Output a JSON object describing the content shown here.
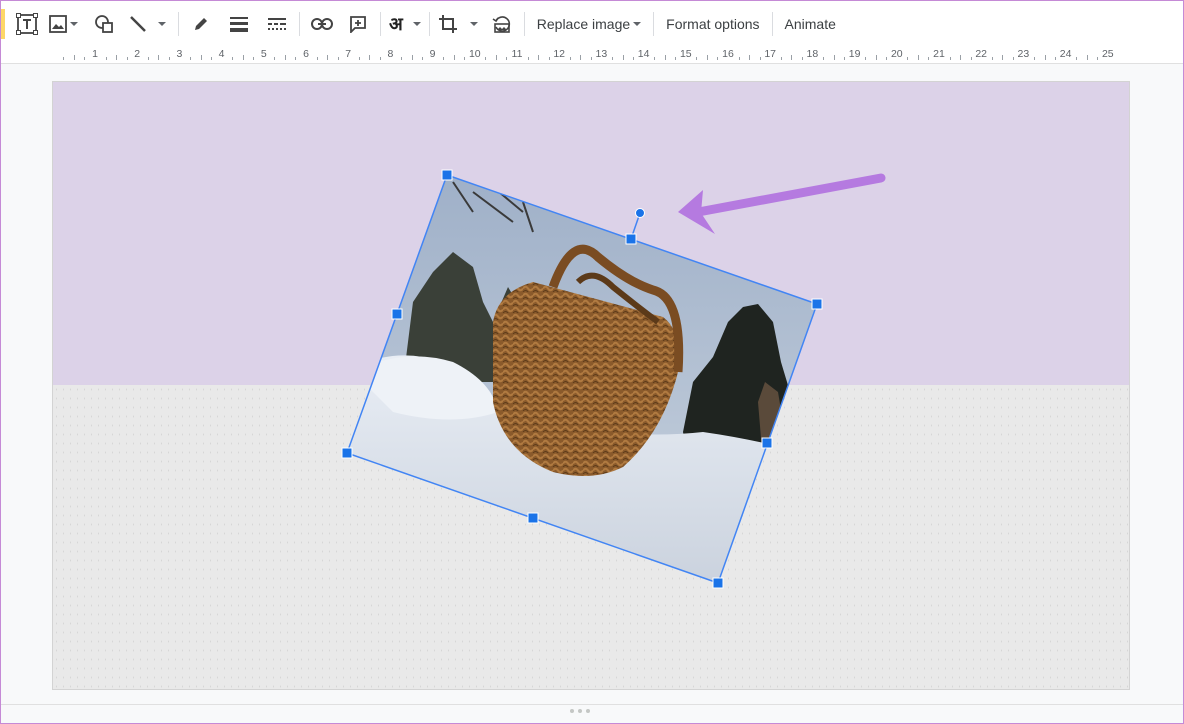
{
  "toolbar": {
    "icons": [
      "text-box-icon",
      "image-icon",
      "shape-icon",
      "line-icon",
      "pen-icon",
      "border-weight-icon",
      "border-dash-icon",
      "link-icon",
      "comment-icon",
      "input-tools-icon",
      "crop-icon",
      "reset-image-icon"
    ],
    "input_tool_glyph": "अ",
    "replace_image_label": "Replace image",
    "format_options_label": "Format options",
    "animate_label": "Animate"
  },
  "ruler": {
    "labels": [
      "1",
      "2",
      "3",
      "4",
      "5",
      "6",
      "7",
      "8",
      "9",
      "10",
      "11",
      "12",
      "13",
      "14",
      "15",
      "16",
      "17",
      "18",
      "19",
      "20",
      "21",
      "22",
      "23",
      "24",
      "25"
    ]
  },
  "colors": {
    "slide_top": "#dcd2e8",
    "slide_bottom": "#e9e9e9",
    "selection": "#4285f4",
    "arrow": "#b57ae0"
  },
  "slide": {
    "image_content": "wicker basket in snow with trees and sky",
    "image_rotation_deg": 22
  }
}
